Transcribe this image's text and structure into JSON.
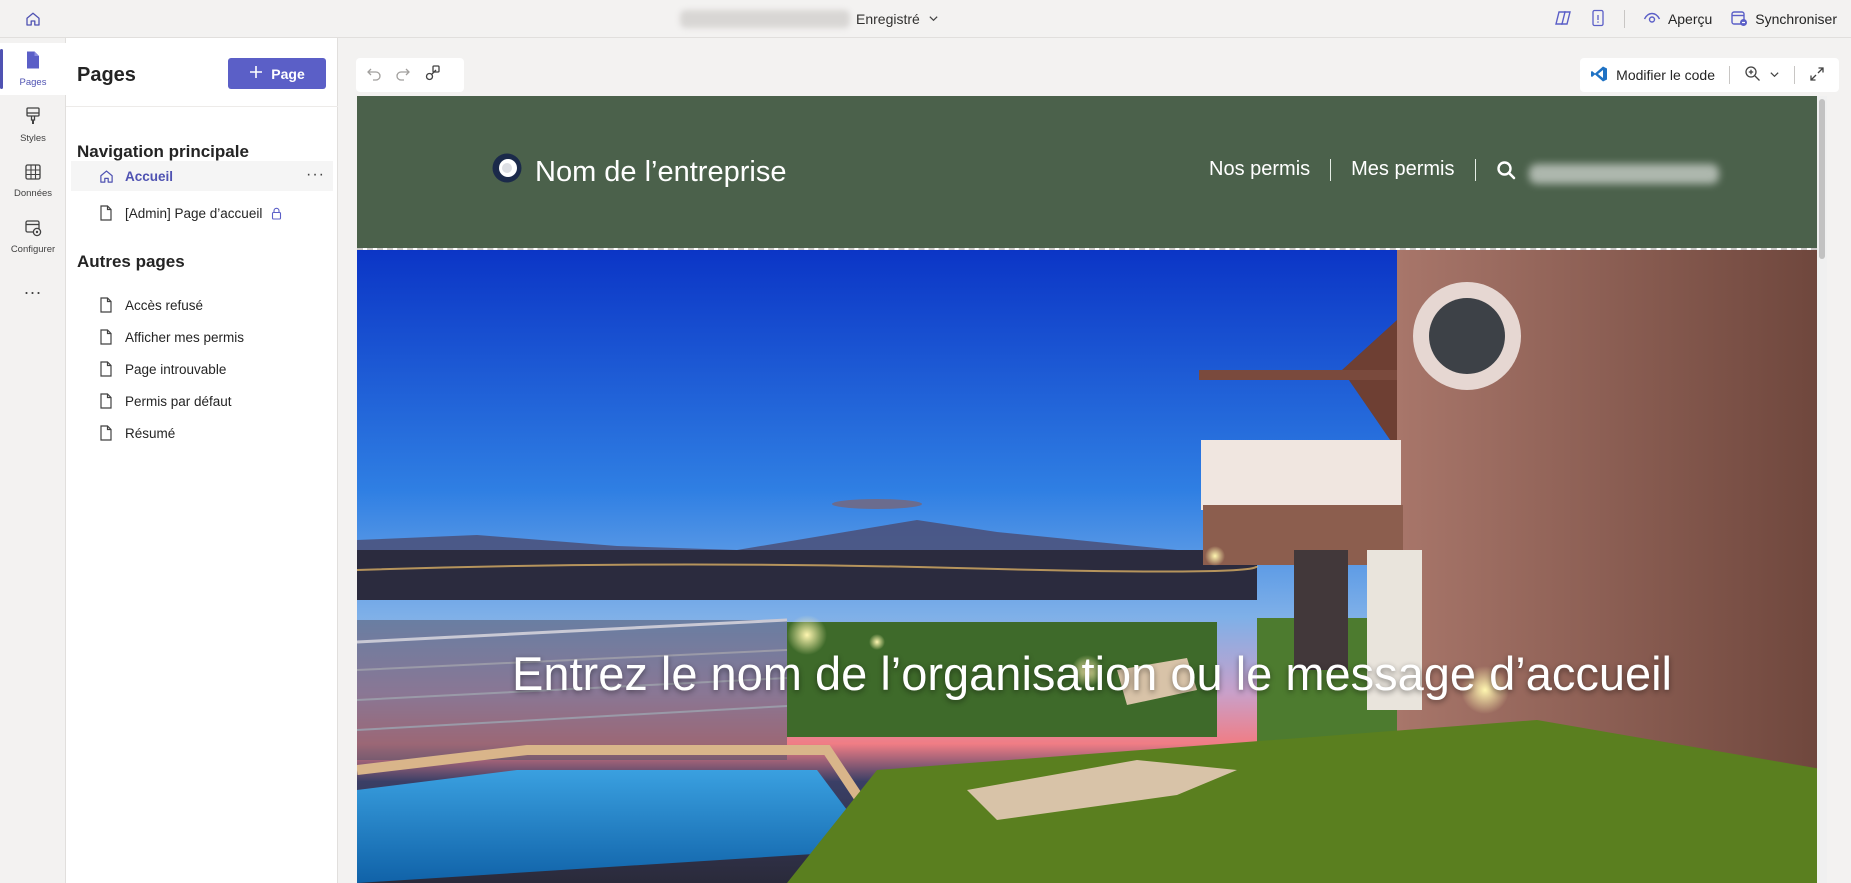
{
  "topbar": {
    "saved_status": "Enregistré",
    "preview_label": "Aperçu",
    "sync_label": "Synchroniser"
  },
  "rail": {
    "items": [
      {
        "label": "Pages"
      },
      {
        "label": "Styles"
      },
      {
        "label": "Données"
      },
      {
        "label": "Configurer"
      }
    ],
    "more": "..."
  },
  "pages_panel": {
    "title": "Pages",
    "add_button": "Page",
    "main_nav_title": "Navigation principale",
    "main_nav": [
      {
        "label": "Accueil",
        "selected": true
      },
      {
        "label": "[Admin] Page d’accueil",
        "locked": true
      }
    ],
    "other_title": "Autres pages",
    "other_pages": [
      {
        "label": "Accès refusé"
      },
      {
        "label": "Afficher mes permis"
      },
      {
        "label": "Page introuvable"
      },
      {
        "label": "Permis par défaut"
      },
      {
        "label": "Résumé"
      }
    ]
  },
  "canvas": {
    "edit_code_label": "Modifier le code"
  },
  "site": {
    "company_name": "Nom de l’entreprise",
    "nav": [
      {
        "label": "Nos permis"
      },
      {
        "label": "Mes permis"
      }
    ],
    "hero_title": "Entrez le nom de l’organisation ou le message d’accueil",
    "header_color": "#4b614b"
  },
  "colors": {
    "accent": "#5b5fc7",
    "accent_text": "#4f52b2"
  }
}
